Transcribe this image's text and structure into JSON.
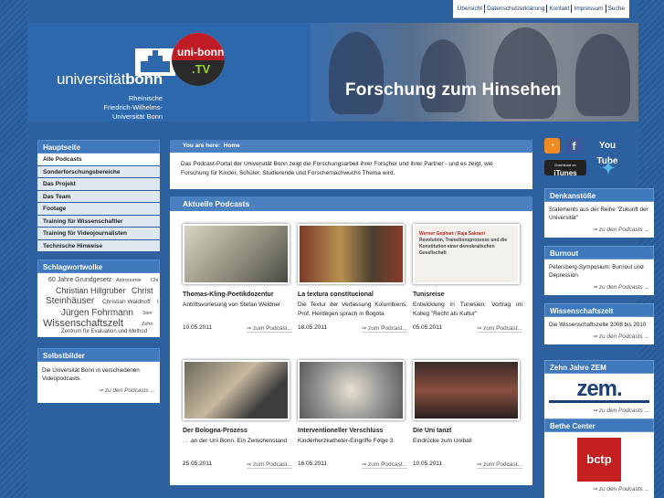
{
  "topnav": [
    "Übersicht",
    "Datenschutzerklärung",
    "Kontakt",
    "Impressum",
    "Suche"
  ],
  "logo": {
    "word_light": "universität",
    "word_bold": "bonn",
    "sub1": "Rheinische",
    "sub2": "Friedrich-Wilhelms-",
    "sub3": "Universität Bonn",
    "tv1": "uni-bonn",
    "tv2": ".TV"
  },
  "banner_title": "Forschung zum Hinsehen",
  "left": {
    "menu_title": "Hauptseite",
    "menu": [
      "Alle Podcasts",
      "Sonderforschungsbereiche",
      "Das Projekt",
      "Das Team",
      "Footage",
      "Training für Wissenschaftler",
      "Training für Videojournalisten",
      "Technische Hinweise"
    ],
    "tags_title": "Schlagwortwolke",
    "tags": [
      "60 Jahre Grundgesetz",
      "Astronomie",
      "Chi",
      "Christian Hillgruber",
      "Christ",
      "Steinhäuser",
      "Christian Waldhoff",
      "I",
      "Jürgen Fohrmann",
      "Sterr",
      "Wissenschaftszelt",
      "Zehn",
      "Zentrum für Evaluation und Method"
    ],
    "selbst_title": "Selbstbilder",
    "selbst_text": "Die Universität Bonn in verschiedenen Videopodcasts.",
    "selbst_more": "zu den Podcasts ..."
  },
  "center": {
    "crumb_label": "You are here:",
    "crumb_page": "Home",
    "intro": "Das Podcast-Portal der Universität Bonn zeigt die Forschungsarbeit ihrer Forscher und ihrer Partner - und es zeigt, wie Forschung für Kinder, Schüler, Studierende und Forschernachwuchs Thema wird.",
    "section": "Aktuelle Podcasts",
    "more": "zum Podcast...",
    "cards": [
      {
        "title": "Thomas-Kling-Poetikdozentur",
        "desc": "Antrittsvorlesung von Stefan Weidner",
        "date": "10.05.2011"
      },
      {
        "title": "La textura constitucional",
        "desc": "Die Textur der Verfassung Kolumbiens. Prof. Herdegen sprach in Bogota",
        "date": "18.05.2011"
      },
      {
        "title": "Tunisreise",
        "desc": "Entwicklung in Tunesien: Vortrag im Kolleg \"Recht als Kultur\"",
        "date": "05.05.2011"
      },
      {
        "title": "Der Bologna-Prozess",
        "desc": ". . .an der Uni Bonn. Ein Zwischenstand",
        "date": "25.05.2011"
      },
      {
        "title": "Interventioneller Verschluss",
        "desc": "Kinderherzkatheter-Eingriffe Folge 3",
        "date": "16.05.2011"
      },
      {
        "title": "Die Uni tanzt",
        "desc": "Eindrücke zum Uniball",
        "date": "10.05.2011"
      }
    ],
    "book_title": "Werner Gephart / Raja Sakrani",
    "book_sub": "Revolution, Transitionsprozesse und die Konstitution einer demokratischen Gesellschaft"
  },
  "social": {
    "youtube": "You Tube",
    "itunes": "iTunes",
    "itunes_small": "Download on"
  },
  "right": [
    {
      "title": "Denkanstöße",
      "text": "Statements aus der Reihe \"Zukunft der Universität\"",
      "more": "zu den Podcasts ..."
    },
    {
      "title": "Burnout",
      "text": "Petersberg-Symposium: Burnout und Depression",
      "more": "zu den Podcasts ..."
    },
    {
      "title": "Wissenschaftszelt",
      "text": "Die Wissenschaftszelte 2008 bis 2010",
      "more": "zu den Podcasts ..."
    },
    {
      "title": "Zehn Jahre ZEM",
      "logo": "zem.",
      "more": "zu den Podcasts ..."
    },
    {
      "title": "Bethe Center",
      "logo": "bctp",
      "more": "zu den Podcasts ..."
    }
  ]
}
